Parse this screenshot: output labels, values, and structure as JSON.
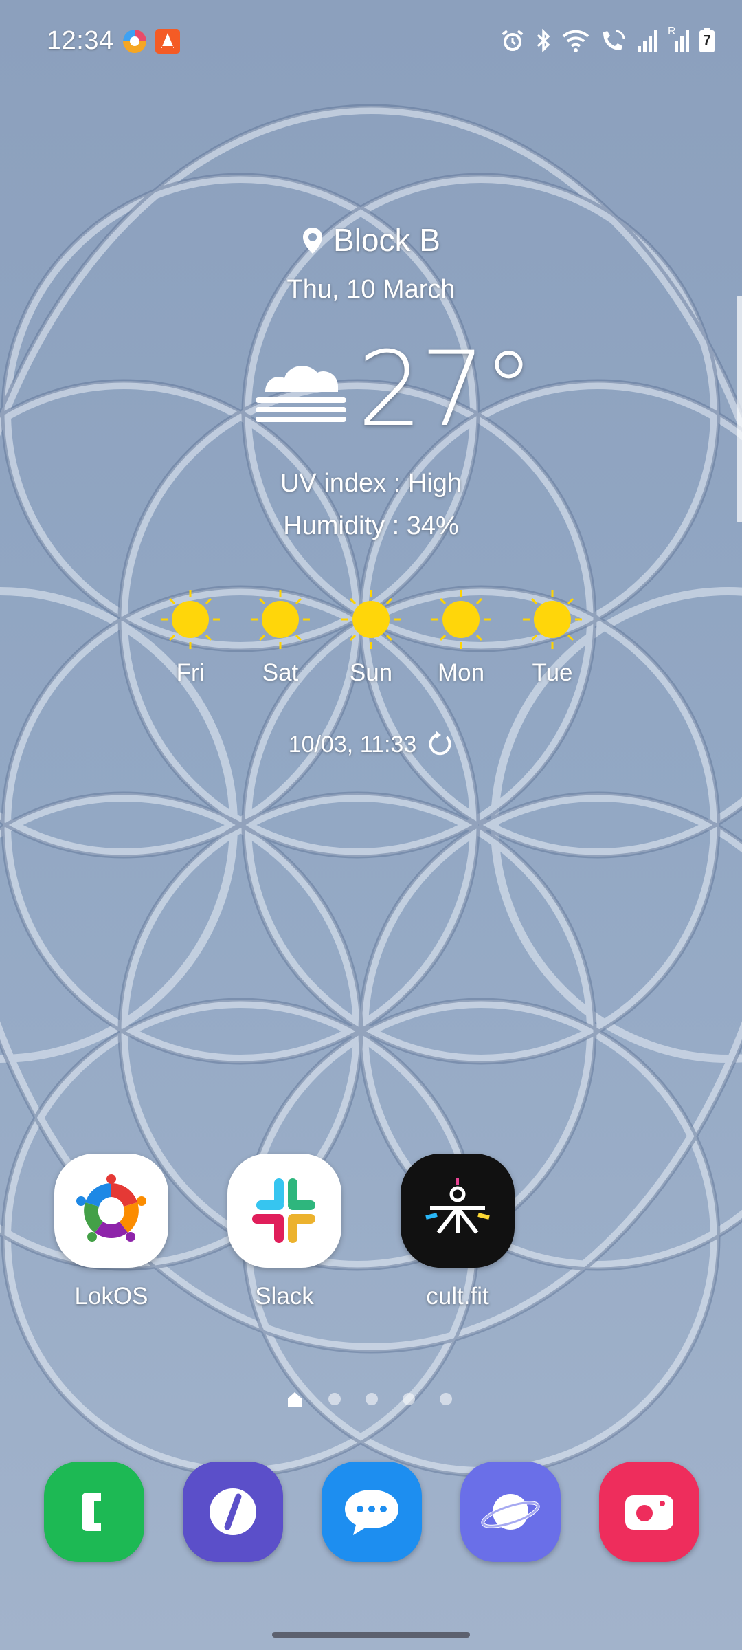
{
  "status_bar": {
    "time": "12:34",
    "notification_icons": [
      "browser-icon",
      "vlc-icon"
    ],
    "system_icons": [
      "alarm-icon",
      "bluetooth-icon",
      "wifi-icon",
      "wifi-calling-icon",
      "signal-icon",
      "roaming-signal-icon",
      "battery-icon"
    ],
    "roaming_label": "R",
    "battery_level": "7"
  },
  "weather": {
    "location": "Block B",
    "date": "Thu, 10 March",
    "condition_icon": "haze-cloud-icon",
    "temperature": "27°",
    "uv": "UV index : High",
    "humidity": "Humidity : 34%",
    "forecast": [
      {
        "day": "Fri",
        "icon": "sun-icon"
      },
      {
        "day": "Sat",
        "icon": "sun-icon"
      },
      {
        "day": "Sun",
        "icon": "sun-icon"
      },
      {
        "day": "Mon",
        "icon": "sun-icon"
      },
      {
        "day": "Tue",
        "icon": "sun-icon"
      }
    ],
    "updated": "10/03, 11:33"
  },
  "apps": [
    {
      "label": "LokOS",
      "icon": "lokos-icon"
    },
    {
      "label": "Slack",
      "icon": "slack-icon"
    },
    {
      "label": "cult.fit",
      "icon": "cult-fit-icon"
    }
  ],
  "page_indicator": {
    "pages": 5,
    "current": 1
  },
  "dock": [
    {
      "name": "phone",
      "icon": "phone-icon",
      "color": "#1db954"
    },
    {
      "name": "slash-app",
      "icon": "slash-icon",
      "color": "#5b4fc9"
    },
    {
      "name": "messages",
      "icon": "messages-icon",
      "color": "#1d8ef0"
    },
    {
      "name": "internet",
      "icon": "planet-icon",
      "color": "#6a6fe8"
    },
    {
      "name": "camera",
      "icon": "camera-icon",
      "color": "#ee2d5c"
    }
  ]
}
